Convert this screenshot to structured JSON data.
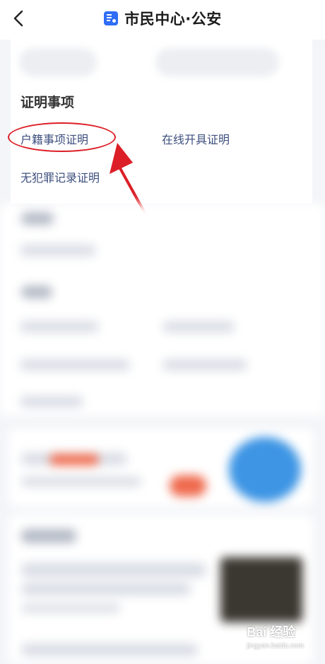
{
  "nav": {
    "title": "市民中心·公安",
    "back_icon": "chevron-left-icon",
    "title_icon": "id-card-icon",
    "icon_color": "#2f6df6"
  },
  "certificates": {
    "section_title": "证明事项",
    "items": [
      {
        "label": "户籍事项证明"
      },
      {
        "label": "在线开具证明"
      },
      {
        "label": "无犯罪记录证明"
      }
    ]
  },
  "annotation": {
    "color": "#dc1f26",
    "target": "户籍事项证明"
  },
  "watermark": {
    "logo": "Bai 经验",
    "sub": "jingyan.baidu.com"
  }
}
